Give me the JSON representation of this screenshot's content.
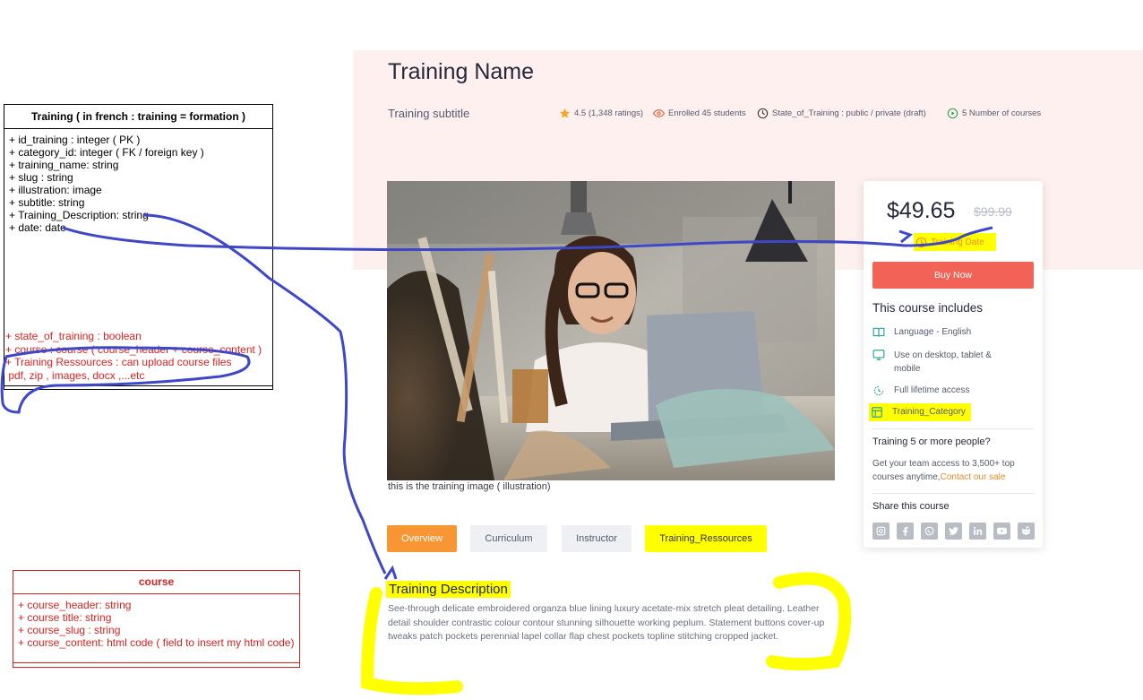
{
  "uml_training": {
    "title": "Training ( in french : training = formation )",
    "fields": [
      "+ id_training : integer ( PK )",
      "+ category_id: integer ( FK / foreign key )",
      "+ training_name: string",
      "+ slug : string",
      "+ illustration: image",
      "+ subtitle: string",
      "+ Training_Description: string",
      "+ date: date"
    ],
    "red_fields": [
      "+ state_of_training : boolean",
      "+ course : course ( course_header + course_content )",
      "+ Training Ressources : can upload course files",
      " pdf, zip , images, docx ,...etc"
    ]
  },
  "uml_course": {
    "title": "course",
    "fields": [
      "+ course_header: string",
      "+ course title: string",
      "+ course_slug : string",
      "+ course_content: html code ( field to insert my html code)"
    ]
  },
  "training": {
    "name": "Training Name",
    "subtitle": "Training subtitle",
    "rating": "4.5 (1,348 ratings)",
    "enrolled": "Enrolled 45 students",
    "state": "State_of_Training : public / private (draft)",
    "courses": "5 Number of courses",
    "image_caption": "this is the training image ( illustration)"
  },
  "tabs": [
    {
      "label": "Overview"
    },
    {
      "label": "Curriculum"
    },
    {
      "label": "Instructor"
    },
    {
      "label": "Training_Ressources"
    }
  ],
  "description": {
    "title": "Training Description",
    "text": "See-through delicate embroidered organza blue lining luxury acetate-mix stretch pleat detailing. Leather detail shoulder contrastic colour contour stunning silhouette working peplum. Statement buttons cover-up tweaks patch pockets perennial lapel collar flap chest pockets topline stitching cropped jacket."
  },
  "card": {
    "price": "$49.65",
    "old_price": "$99.99",
    "date": "Training Date",
    "buy_label": "Buy Now",
    "includes_title": "This course includes",
    "includes": [
      {
        "icon": "book-icon",
        "text": "Language - English"
      },
      {
        "icon": "monitor-icon",
        "text": "Use on desktop, tablet & mobile"
      },
      {
        "icon": "infinity-icon",
        "text": "Full lifetime access"
      },
      {
        "icon": "layout-icon",
        "text": "Training_Category"
      }
    ],
    "team_title": "Training 5 or more people?",
    "team_text": "Get your team access to 3,500+ top courses anytime,",
    "contact_label": "Contact our sale",
    "share_title": "Share this course",
    "socials": [
      "instagram-icon",
      "facebook-icon",
      "whatsapp-icon",
      "twitter-icon",
      "linkedin-icon",
      "youtube-icon",
      "reddit-icon"
    ]
  },
  "colors": {
    "accent_orange": "#f79633",
    "buy_red": "#f26257",
    "hero_bg": "#fdf0ee",
    "highlight_yellow": "#ffff00",
    "annotation_blue": "#3d47c8",
    "uml_red": "#d9221e"
  }
}
